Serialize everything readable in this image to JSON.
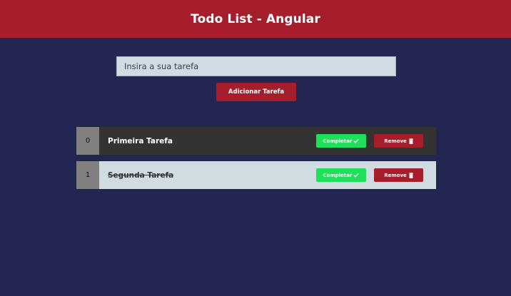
{
  "header": {
    "title": "Todo List - Angular"
  },
  "form": {
    "input_placeholder": "Insira a sua tarefa",
    "input_value": "",
    "add_button_label": "Adicionar Tarefa"
  },
  "todos": [
    {
      "index": "0",
      "title": "Primeira Tarefa",
      "completed": false,
      "complete_label": "Completar",
      "remove_label": "Remove"
    },
    {
      "index": "1",
      "title": "Segunda Tarefa",
      "completed": true,
      "complete_label": "Completar",
      "remove_label": "Remove"
    }
  ],
  "icons": {
    "complete": "check-icon",
    "remove": "trash-icon"
  },
  "colors": {
    "background": "#222651",
    "header": "#a61e2c",
    "input": "#d1dbe2",
    "complete_button": "#1ee05a",
    "remove_button": "#a61e2c",
    "pending_row": "#333333",
    "completed_row": "#d1dbe2",
    "index_cell": "#808080"
  }
}
